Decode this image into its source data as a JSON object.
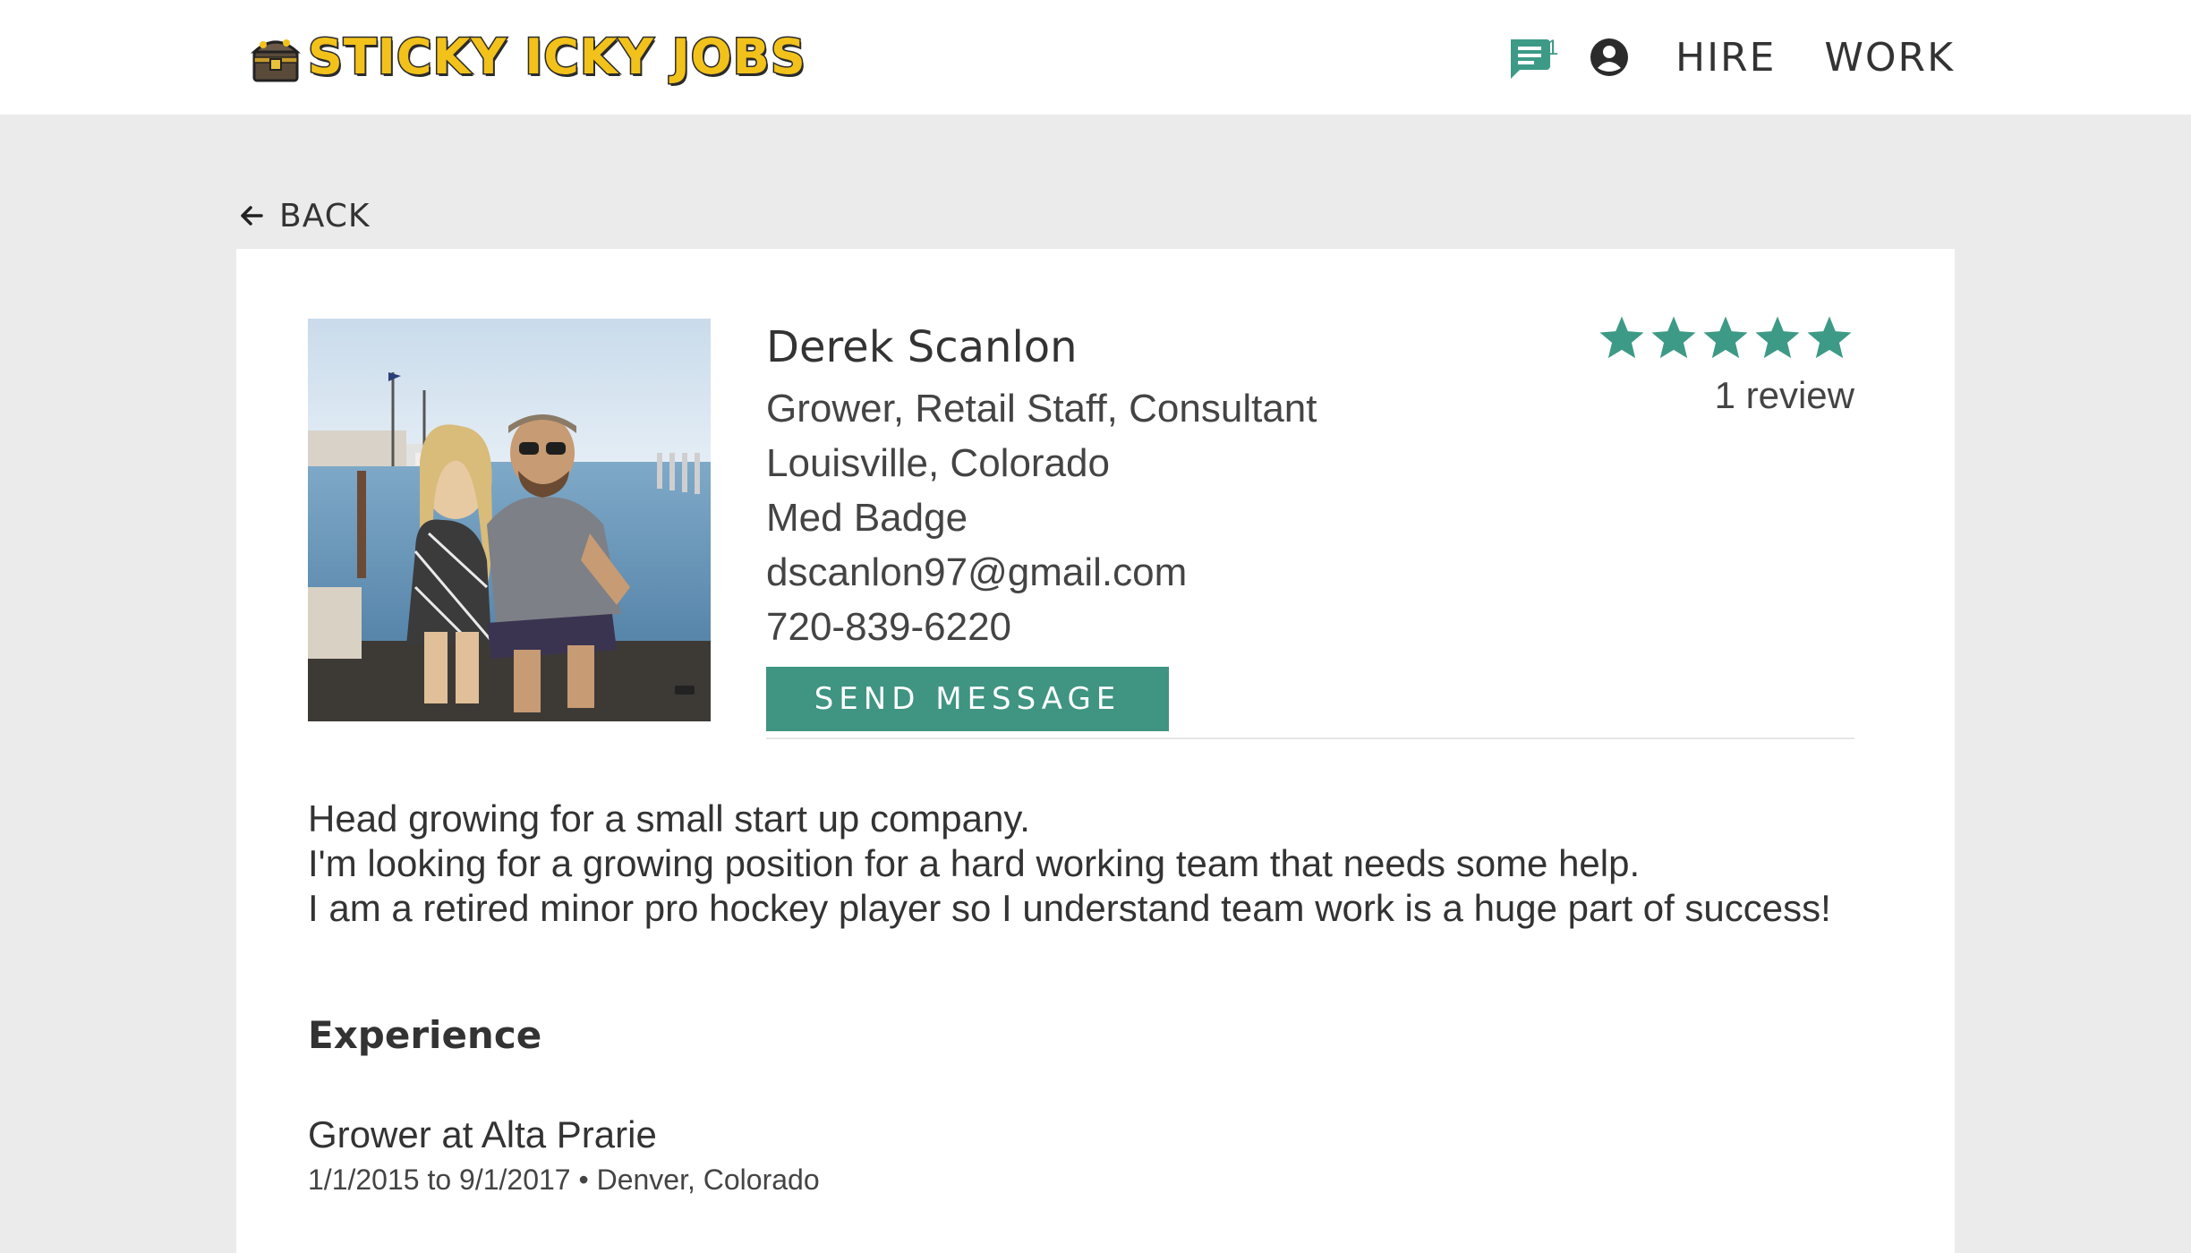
{
  "header": {
    "logo_text": "STICKY ICKY JOBS",
    "chat_badge": "1",
    "nav": [
      "HIRE",
      "WORK"
    ]
  },
  "back_label": "BACK",
  "profile": {
    "name": "Derek Scanlon",
    "roles": "Grower, Retail Staff, Consultant",
    "location": "Louisville, Colorado",
    "badge": "Med Badge",
    "email": "dscanlon97@gmail.com",
    "phone": "720-839-6220",
    "send_label": "SEND MESSAGE",
    "rating": 5,
    "review_count": "1 review"
  },
  "bio": [
    "Head growing for a small start up company.",
    "I'm looking for a growing position for a hard working team that needs some help.",
    "I am a retired minor pro hockey player so I understand team work is a huge part of success!"
  ],
  "experience": {
    "title": "Experience",
    "items": [
      {
        "role": "Grower at Alta Prarie",
        "meta": "1/1/2015 to 9/1/2017 • Denver, Colorado"
      }
    ]
  },
  "colors": {
    "accent": "#3f9482",
    "star": "#3d9a87",
    "logo_yellow": "#f2c21b"
  },
  "icons": {
    "chat": "chat-icon",
    "account": "account-circle-icon",
    "back": "arrow-left-icon",
    "star": "star-icon"
  }
}
